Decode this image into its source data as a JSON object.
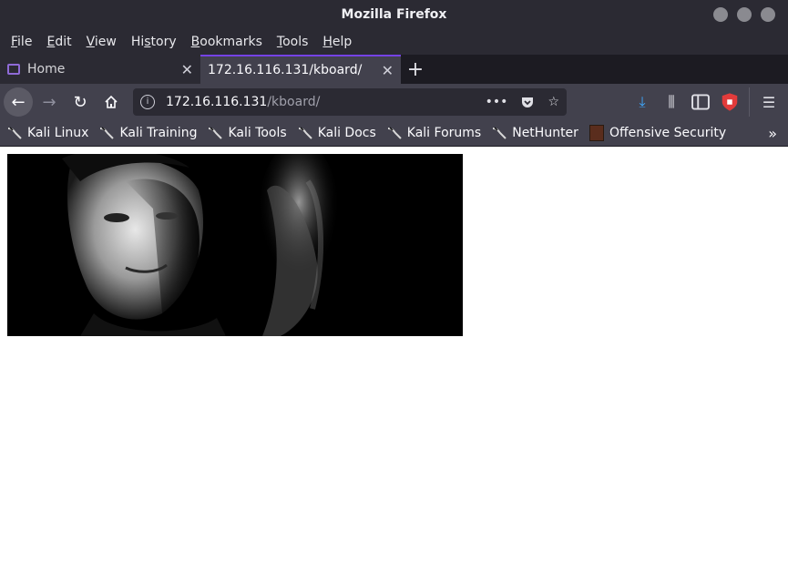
{
  "window": {
    "title": "Mozilla Firefox"
  },
  "menu": [
    {
      "pre": "",
      "u": "F",
      "post": "ile"
    },
    {
      "pre": "",
      "u": "E",
      "post": "dit"
    },
    {
      "pre": "",
      "u": "V",
      "post": "iew"
    },
    {
      "pre": "Hi",
      "u": "s",
      "post": "tory"
    },
    {
      "pre": "",
      "u": "B",
      "post": "ookmarks"
    },
    {
      "pre": "",
      "u": "T",
      "post": "ools"
    },
    {
      "pre": "",
      "u": "H",
      "post": "elp"
    }
  ],
  "tabs": [
    {
      "label": "Home",
      "active": false
    },
    {
      "label": "172.16.116.131/kboard/",
      "active": true
    }
  ],
  "url": {
    "host": "172.16.116.131",
    "path": "/kboard/"
  },
  "bookmarks": [
    "Kali Linux",
    "Kali Training",
    "Kali Tools",
    "Kali Docs",
    "Kali Forums",
    "NetHunter",
    "Offensive Security"
  ],
  "colors": {
    "accent": "#7542e5",
    "toolbar": "#42414d",
    "titlebar": "#2b2a33"
  }
}
